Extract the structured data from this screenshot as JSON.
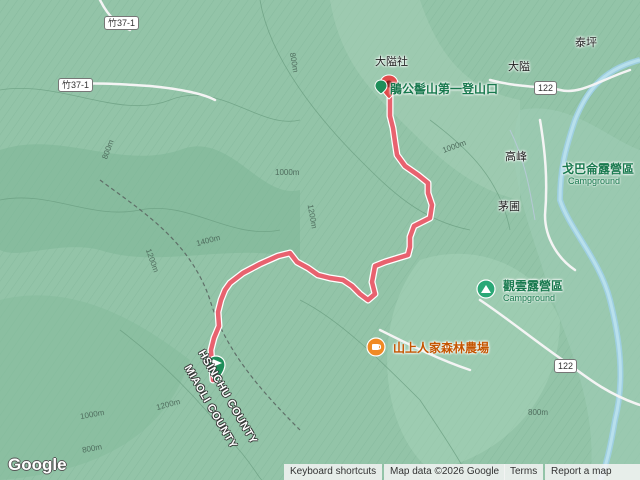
{
  "map": {
    "trail_color": "#e8626f",
    "trail_highlight": "#ffffff",
    "road_color": "#a7d0dd",
    "terrain_color": "#8fc2a6",
    "poi": {
      "trailhead": "鵑公髻山第一登山口",
      "ridge_camp": "觀雲露營區",
      "ridge_camp_sub": "Campground",
      "river_camp": "戈巴侖露營區",
      "river_camp_sub": "Campground",
      "farm": "山上人家森林農場"
    },
    "places": {
      "village": "大隘社",
      "dai": "大隘",
      "taiping": "泰坪",
      "gaofeng": "高峰",
      "maoyuan": "茅圃"
    },
    "roads": {
      "zhu37_1_top": "竹37-1",
      "zhu37_1_left": "竹37-1",
      "route122_top": "122",
      "route122_bottom": "122"
    },
    "counties": {
      "hsinchu": "HSINCHU COUNTY",
      "miaoli": "MIAOLI COUNTY"
    },
    "contours": {
      "c800_a": "800m",
      "c800_b": "800m",
      "c1000_a": "1000m",
      "c1000_b": "1000m",
      "c1200_a": "1200m",
      "c1200_b": "1200m",
      "c1400": "1400m",
      "c1000_c": "1000m",
      "c800_c": "800m",
      "c800_d": "800m",
      "c1200_c": "1200m"
    },
    "icons": {
      "trailhead": "map-pin-icon",
      "start": "start-flag-icon",
      "camp": "camping-icon",
      "farm": "restaurant-icon"
    }
  },
  "footer": {
    "logo": "Google",
    "keyboard_shortcuts": "Keyboard shortcuts",
    "map_data": "Map data ©2026 Google",
    "terms": "Terms",
    "report": "Report a map error"
  }
}
